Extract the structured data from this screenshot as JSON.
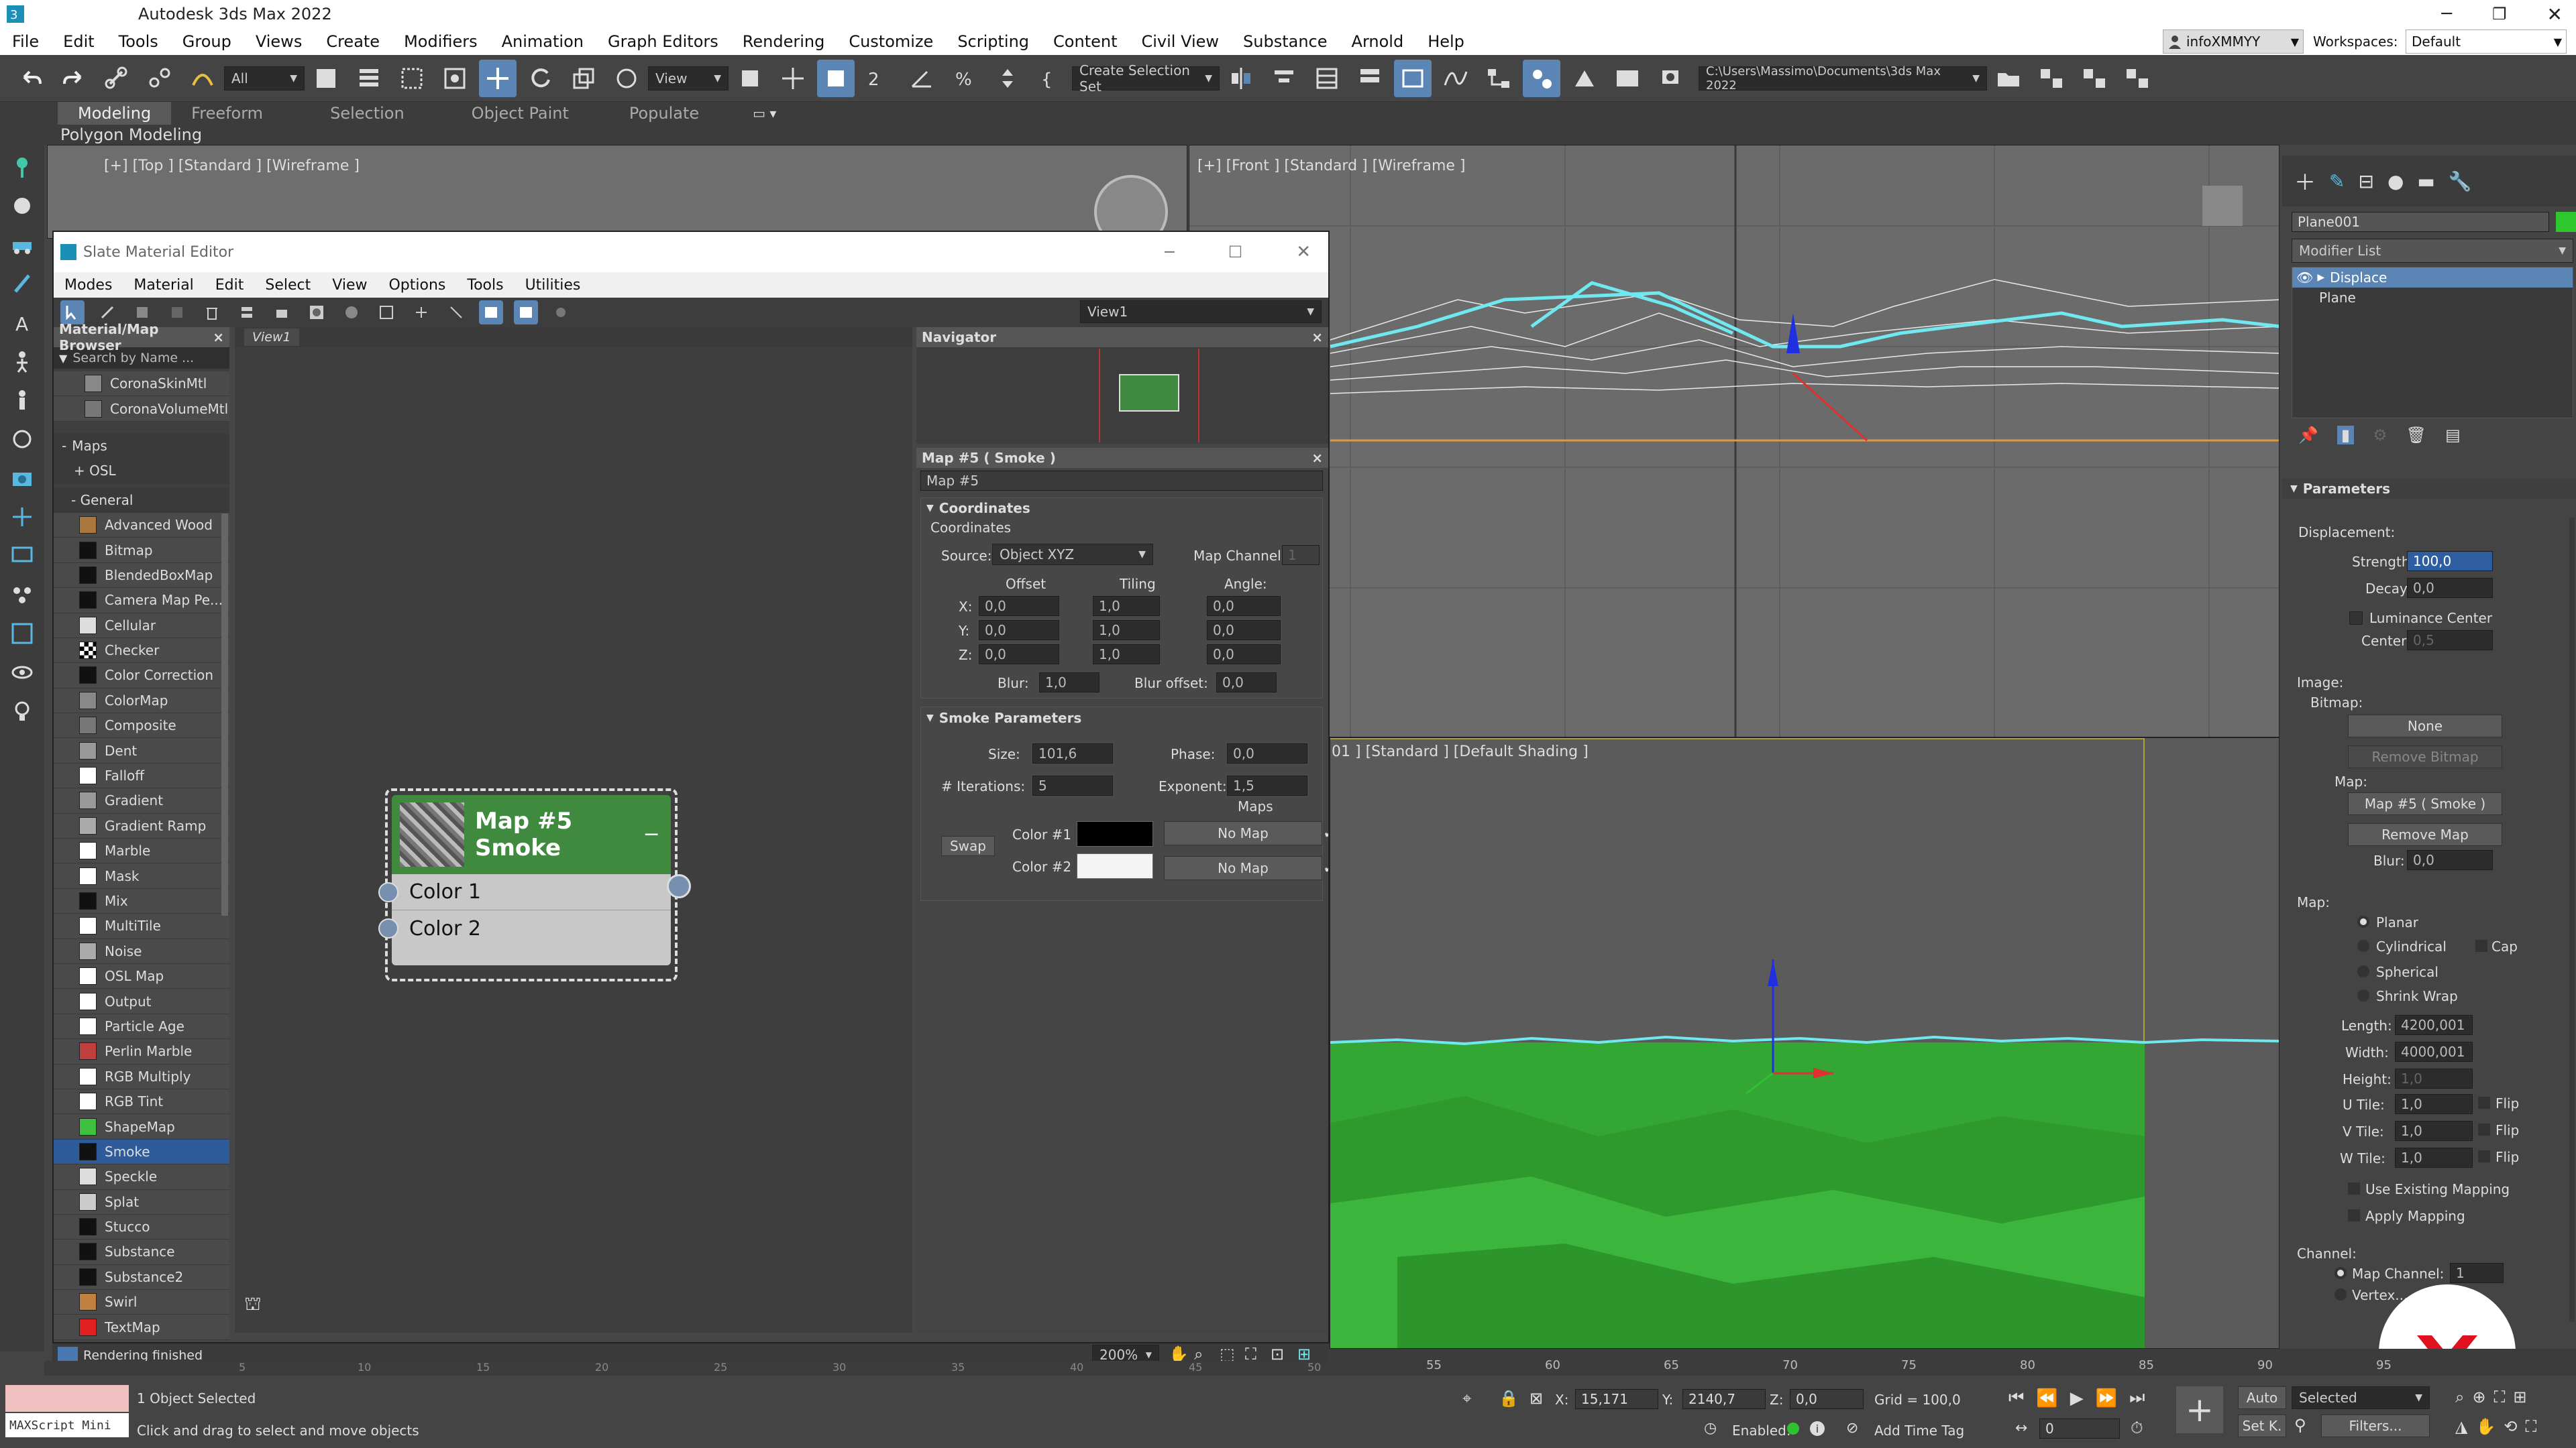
{
  "app": {
    "title": "Autodesk 3ds Max 2022",
    "user": "infoXMMYY",
    "workspaces_label": "Workspaces:",
    "workspace": "Default"
  },
  "menu": [
    "File",
    "Edit",
    "Tools",
    "Group",
    "Views",
    "Create",
    "Modifiers",
    "Animation",
    "Graph Editors",
    "Rendering",
    "Customize",
    "Scripting",
    "Content",
    "Civil View",
    "Substance",
    "Arnold",
    "Help"
  ],
  "toolbar": {
    "filter": "All",
    "view": "View",
    "selection_set": "Create Selection Set",
    "path": "C:\\Users\\Massimo\\Documents\\3ds Max 2022"
  },
  "ribbon": {
    "tabs": [
      "Modeling",
      "Freeform",
      "Selection",
      "Object Paint",
      "Populate"
    ],
    "sub": "Polygon Modeling"
  },
  "viewports": {
    "top": "[+] [Top ] [Standard ] [Wireframe ]",
    "front": "[+] [Front ] [Standard ] [Wireframe ]",
    "persp": "01 ] [Standard ] [Default Shading ]"
  },
  "sme": {
    "title": "Slate Material Editor",
    "menu": [
      "Modes",
      "Material",
      "Edit",
      "Select",
      "View",
      "Options",
      "Tools",
      "Utilities"
    ],
    "view_dropdown": "View1",
    "browser_title": "Material/Map Browser",
    "search_placeholder": "Search by Name ...",
    "top_items": [
      "CoronaSkinMtl",
      "CoronaVolumeMtl"
    ],
    "maps_group": "Maps",
    "osl_group": "+ OSL",
    "general_group": "- General",
    "maps": [
      "Advanced Wood",
      "Bitmap",
      "BlendedBoxMap",
      "Camera Map Pe...",
      "Cellular",
      "Checker",
      "Color Correction",
      "ColorMap",
      "Composite",
      "Dent",
      "Falloff",
      "Gradient",
      "Gradient Ramp",
      "Marble",
      "Mask",
      "Mix",
      "MultiTile",
      "Noise",
      "OSL Map",
      "Output",
      "Particle Age",
      "Perlin Marble",
      "RGB Multiply",
      "RGB Tint",
      "ShapeMap",
      "Smoke",
      "Speckle",
      "Splat",
      "Stucco",
      "Substance",
      "Substance2",
      "Swirl",
      "TextMap"
    ],
    "selected_map": "Smoke",
    "view_tab": "View1",
    "node": {
      "title1": "Map #5",
      "title2": "Smoke",
      "slot1": "Color 1",
      "slot2": "Color 2"
    },
    "navigator": "Navigator",
    "zoom": "200%",
    "status": "Rendering finished",
    "params_title": "Map #5 ( Smoke )",
    "map_name": "Map #5",
    "coords": {
      "rollout": "Coordinates",
      "group": "Coordinates",
      "source_label": "Source:",
      "source": "Object XYZ",
      "map_channel_label": "Map Channel:",
      "map_channel": "1",
      "offset": "Offset",
      "tiling": "Tiling",
      "angle": "Angle:",
      "rows": [
        {
          "axis": "X:",
          "offset": "0,0",
          "tiling": "1,0",
          "angle": "0,0"
        },
        {
          "axis": "Y:",
          "offset": "0,0",
          "tiling": "1,0",
          "angle": "0,0"
        },
        {
          "axis": "Z:",
          "offset": "0,0",
          "tiling": "1,0",
          "angle": "0,0"
        }
      ],
      "blur_label": "Blur:",
      "blur": "1,0",
      "blur_offset_label": "Blur offset:",
      "blur_offset": "0,0"
    },
    "smoke": {
      "rollout": "Smoke Parameters",
      "size_label": "Size:",
      "size": "101,6",
      "phase_label": "Phase:",
      "phase": "0,0",
      "iter_label": "# Iterations:",
      "iter": "5",
      "exp_label": "Exponent:",
      "exp": "1,5",
      "maps_label": "Maps",
      "swap": "Swap",
      "color1_label": "Color #1",
      "color2_label": "Color #2",
      "nomap": "No Map"
    }
  },
  "cmd": {
    "object": "Plane001",
    "modifier_list": "Modifier List",
    "stack": [
      "Displace",
      "Plane"
    ],
    "params": "Parameters",
    "displacement": "Displacement:",
    "strength_label": "Strength:",
    "strength": "100,0",
    "decay_label": "Decay:",
    "decay": "0,0",
    "lum_center": "Luminance Center",
    "center_label": "Center:",
    "center": "0,5",
    "image": "Image:",
    "bitmap": "Bitmap:",
    "none": "None",
    "remove_bitmap": "Remove Bitmap",
    "map_label": "Map:",
    "map_value": "Map #5 ( Smoke )",
    "remove_map": "Remove Map",
    "blur_label": "Blur:",
    "blur": "0,0",
    "map_group": "Map:",
    "planar": "Planar",
    "cylindrical": "Cylindrical",
    "cap": "Cap",
    "spherical": "Spherical",
    "shrink": "Shrink Wrap",
    "length_label": "Length:",
    "length": "4200,001",
    "width_label": "Width:",
    "width": "4000,001",
    "height_label": "Height:",
    "height": "1,0",
    "utile_label": "U Tile:",
    "utile": "1,0",
    "vtile_label": "V Tile:",
    "vtile": "1,0",
    "wtile_label": "W Tile:",
    "wtile": "1,0",
    "flip": "Flip",
    "use_existing": "Use Existing Mapping",
    "apply_mapping": "Apply Mapping",
    "channel": "Channel:",
    "map_channel": "Map Channel:",
    "map_channel_value": "1",
    "vertex": "Vertex..."
  },
  "timeline_ticks": [
    "55",
    "60",
    "65",
    "70",
    "75",
    "80",
    "85",
    "90",
    "95"
  ],
  "left_ticks": [
    "5",
    "10",
    "15",
    "20",
    "25",
    "30",
    "35",
    "40",
    "45",
    "50"
  ],
  "status": {
    "maxscript": "MAXScript Mini",
    "selected": "1 Object Selected",
    "hint": "Click and drag to select and move objects",
    "x_label": "X:",
    "x": "15,171",
    "y_label": "Y:",
    "y": "2140,7",
    "z_label": "Z:",
    "z": "0,0",
    "grid": "Grid = 100,0",
    "enabled": "Enabled:",
    "add_time_tag": "Add Time Tag",
    "auto": "Auto",
    "selected_dd": "Selected",
    "setk": "Set K.",
    "filters": "Filters...",
    "frame": "0"
  },
  "colors": {
    "accent": "#5a85b5",
    "node_green": "#3f8a3f",
    "terrain": "#33b233",
    "wire": "#6fe8f0"
  }
}
